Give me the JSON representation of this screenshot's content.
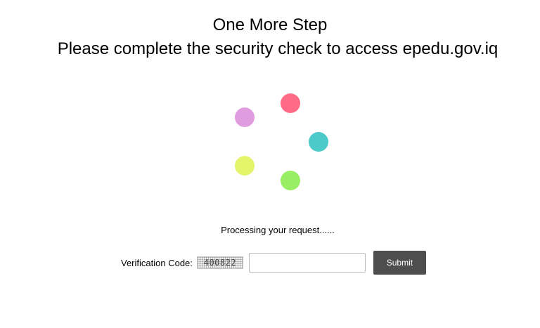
{
  "header": {
    "title": "One More Step",
    "subtitle": "Please complete the security check to access epedu.gov.iq"
  },
  "spinner": {
    "dots": [
      {
        "name": "pink",
        "color": "#ff6b86"
      },
      {
        "name": "violet",
        "color": "#df9de0"
      },
      {
        "name": "teal",
        "color": "#4cc9c9"
      },
      {
        "name": "yellow",
        "color": "#e4f56c"
      },
      {
        "name": "green",
        "color": "#98ee64"
      }
    ]
  },
  "status": {
    "text": "Processing your request......"
  },
  "verification": {
    "label": "Verification Code:",
    "code": "400822",
    "input_value": "",
    "submit_label": "Submit",
    "submit_color": "#4e4e4e"
  }
}
